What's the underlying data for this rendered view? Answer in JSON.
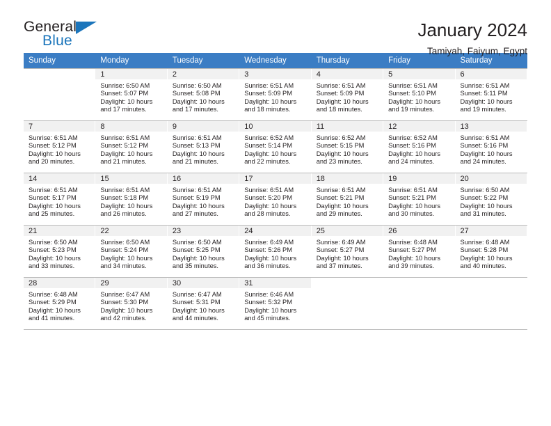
{
  "brand": {
    "name_part1": "General",
    "name_part2": "Blue",
    "triangle_color": "#1b75bb"
  },
  "header": {
    "title": "January 2024",
    "subtitle": "Tamiyah, Faiyum, Egypt"
  },
  "theme": {
    "header_row_bg": "#3b7dc4",
    "day_number_bg": "#f1f1f1",
    "grid_line": "#b9b9b9",
    "text": "#231f20"
  },
  "weekday_headers": [
    "Sunday",
    "Monday",
    "Tuesday",
    "Wednesday",
    "Thursday",
    "Friday",
    "Saturday"
  ],
  "labels": {
    "sunrise_prefix": "Sunrise:",
    "sunset_prefix": "Sunset:",
    "daylight_prefix": "Daylight:"
  },
  "weeks": [
    [
      {
        "blank": true
      },
      {
        "day": "1",
        "sunrise": "Sunrise: 6:50 AM",
        "sunset": "Sunset: 5:07 PM",
        "daylight_1": "Daylight: 10 hours",
        "daylight_2": "and 17 minutes."
      },
      {
        "day": "2",
        "sunrise": "Sunrise: 6:50 AM",
        "sunset": "Sunset: 5:08 PM",
        "daylight_1": "Daylight: 10 hours",
        "daylight_2": "and 17 minutes."
      },
      {
        "day": "3",
        "sunrise": "Sunrise: 6:51 AM",
        "sunset": "Sunset: 5:09 PM",
        "daylight_1": "Daylight: 10 hours",
        "daylight_2": "and 18 minutes."
      },
      {
        "day": "4",
        "sunrise": "Sunrise: 6:51 AM",
        "sunset": "Sunset: 5:09 PM",
        "daylight_1": "Daylight: 10 hours",
        "daylight_2": "and 18 minutes."
      },
      {
        "day": "5",
        "sunrise": "Sunrise: 6:51 AM",
        "sunset": "Sunset: 5:10 PM",
        "daylight_1": "Daylight: 10 hours",
        "daylight_2": "and 19 minutes."
      },
      {
        "day": "6",
        "sunrise": "Sunrise: 6:51 AM",
        "sunset": "Sunset: 5:11 PM",
        "daylight_1": "Daylight: 10 hours",
        "daylight_2": "and 19 minutes."
      }
    ],
    [
      {
        "day": "7",
        "sunrise": "Sunrise: 6:51 AM",
        "sunset": "Sunset: 5:12 PM",
        "daylight_1": "Daylight: 10 hours",
        "daylight_2": "and 20 minutes."
      },
      {
        "day": "8",
        "sunrise": "Sunrise: 6:51 AM",
        "sunset": "Sunset: 5:12 PM",
        "daylight_1": "Daylight: 10 hours",
        "daylight_2": "and 21 minutes."
      },
      {
        "day": "9",
        "sunrise": "Sunrise: 6:51 AM",
        "sunset": "Sunset: 5:13 PM",
        "daylight_1": "Daylight: 10 hours",
        "daylight_2": "and 21 minutes."
      },
      {
        "day": "10",
        "sunrise": "Sunrise: 6:52 AM",
        "sunset": "Sunset: 5:14 PM",
        "daylight_1": "Daylight: 10 hours",
        "daylight_2": "and 22 minutes."
      },
      {
        "day": "11",
        "sunrise": "Sunrise: 6:52 AM",
        "sunset": "Sunset: 5:15 PM",
        "daylight_1": "Daylight: 10 hours",
        "daylight_2": "and 23 minutes."
      },
      {
        "day": "12",
        "sunrise": "Sunrise: 6:52 AM",
        "sunset": "Sunset: 5:16 PM",
        "daylight_1": "Daylight: 10 hours",
        "daylight_2": "and 24 minutes."
      },
      {
        "day": "13",
        "sunrise": "Sunrise: 6:51 AM",
        "sunset": "Sunset: 5:16 PM",
        "daylight_1": "Daylight: 10 hours",
        "daylight_2": "and 24 minutes."
      }
    ],
    [
      {
        "day": "14",
        "sunrise": "Sunrise: 6:51 AM",
        "sunset": "Sunset: 5:17 PM",
        "daylight_1": "Daylight: 10 hours",
        "daylight_2": "and 25 minutes."
      },
      {
        "day": "15",
        "sunrise": "Sunrise: 6:51 AM",
        "sunset": "Sunset: 5:18 PM",
        "daylight_1": "Daylight: 10 hours",
        "daylight_2": "and 26 minutes."
      },
      {
        "day": "16",
        "sunrise": "Sunrise: 6:51 AM",
        "sunset": "Sunset: 5:19 PM",
        "daylight_1": "Daylight: 10 hours",
        "daylight_2": "and 27 minutes."
      },
      {
        "day": "17",
        "sunrise": "Sunrise: 6:51 AM",
        "sunset": "Sunset: 5:20 PM",
        "daylight_1": "Daylight: 10 hours",
        "daylight_2": "and 28 minutes."
      },
      {
        "day": "18",
        "sunrise": "Sunrise: 6:51 AM",
        "sunset": "Sunset: 5:21 PM",
        "daylight_1": "Daylight: 10 hours",
        "daylight_2": "and 29 minutes."
      },
      {
        "day": "19",
        "sunrise": "Sunrise: 6:51 AM",
        "sunset": "Sunset: 5:21 PM",
        "daylight_1": "Daylight: 10 hours",
        "daylight_2": "and 30 minutes."
      },
      {
        "day": "20",
        "sunrise": "Sunrise: 6:50 AM",
        "sunset": "Sunset: 5:22 PM",
        "daylight_1": "Daylight: 10 hours",
        "daylight_2": "and 31 minutes."
      }
    ],
    [
      {
        "day": "21",
        "sunrise": "Sunrise: 6:50 AM",
        "sunset": "Sunset: 5:23 PM",
        "daylight_1": "Daylight: 10 hours",
        "daylight_2": "and 33 minutes."
      },
      {
        "day": "22",
        "sunrise": "Sunrise: 6:50 AM",
        "sunset": "Sunset: 5:24 PM",
        "daylight_1": "Daylight: 10 hours",
        "daylight_2": "and 34 minutes."
      },
      {
        "day": "23",
        "sunrise": "Sunrise: 6:50 AM",
        "sunset": "Sunset: 5:25 PM",
        "daylight_1": "Daylight: 10 hours",
        "daylight_2": "and 35 minutes."
      },
      {
        "day": "24",
        "sunrise": "Sunrise: 6:49 AM",
        "sunset": "Sunset: 5:26 PM",
        "daylight_1": "Daylight: 10 hours",
        "daylight_2": "and 36 minutes."
      },
      {
        "day": "25",
        "sunrise": "Sunrise: 6:49 AM",
        "sunset": "Sunset: 5:27 PM",
        "daylight_1": "Daylight: 10 hours",
        "daylight_2": "and 37 minutes."
      },
      {
        "day": "26",
        "sunrise": "Sunrise: 6:48 AM",
        "sunset": "Sunset: 5:27 PM",
        "daylight_1": "Daylight: 10 hours",
        "daylight_2": "and 39 minutes."
      },
      {
        "day": "27",
        "sunrise": "Sunrise: 6:48 AM",
        "sunset": "Sunset: 5:28 PM",
        "daylight_1": "Daylight: 10 hours",
        "daylight_2": "and 40 minutes."
      }
    ],
    [
      {
        "day": "28",
        "sunrise": "Sunrise: 6:48 AM",
        "sunset": "Sunset: 5:29 PM",
        "daylight_1": "Daylight: 10 hours",
        "daylight_2": "and 41 minutes."
      },
      {
        "day": "29",
        "sunrise": "Sunrise: 6:47 AM",
        "sunset": "Sunset: 5:30 PM",
        "daylight_1": "Daylight: 10 hours",
        "daylight_2": "and 42 minutes."
      },
      {
        "day": "30",
        "sunrise": "Sunrise: 6:47 AM",
        "sunset": "Sunset: 5:31 PM",
        "daylight_1": "Daylight: 10 hours",
        "daylight_2": "and 44 minutes."
      },
      {
        "day": "31",
        "sunrise": "Sunrise: 6:46 AM",
        "sunset": "Sunset: 5:32 PM",
        "daylight_1": "Daylight: 10 hours",
        "daylight_2": "and 45 minutes."
      },
      {
        "blank": true
      },
      {
        "blank": true
      },
      {
        "blank": true
      }
    ]
  ]
}
